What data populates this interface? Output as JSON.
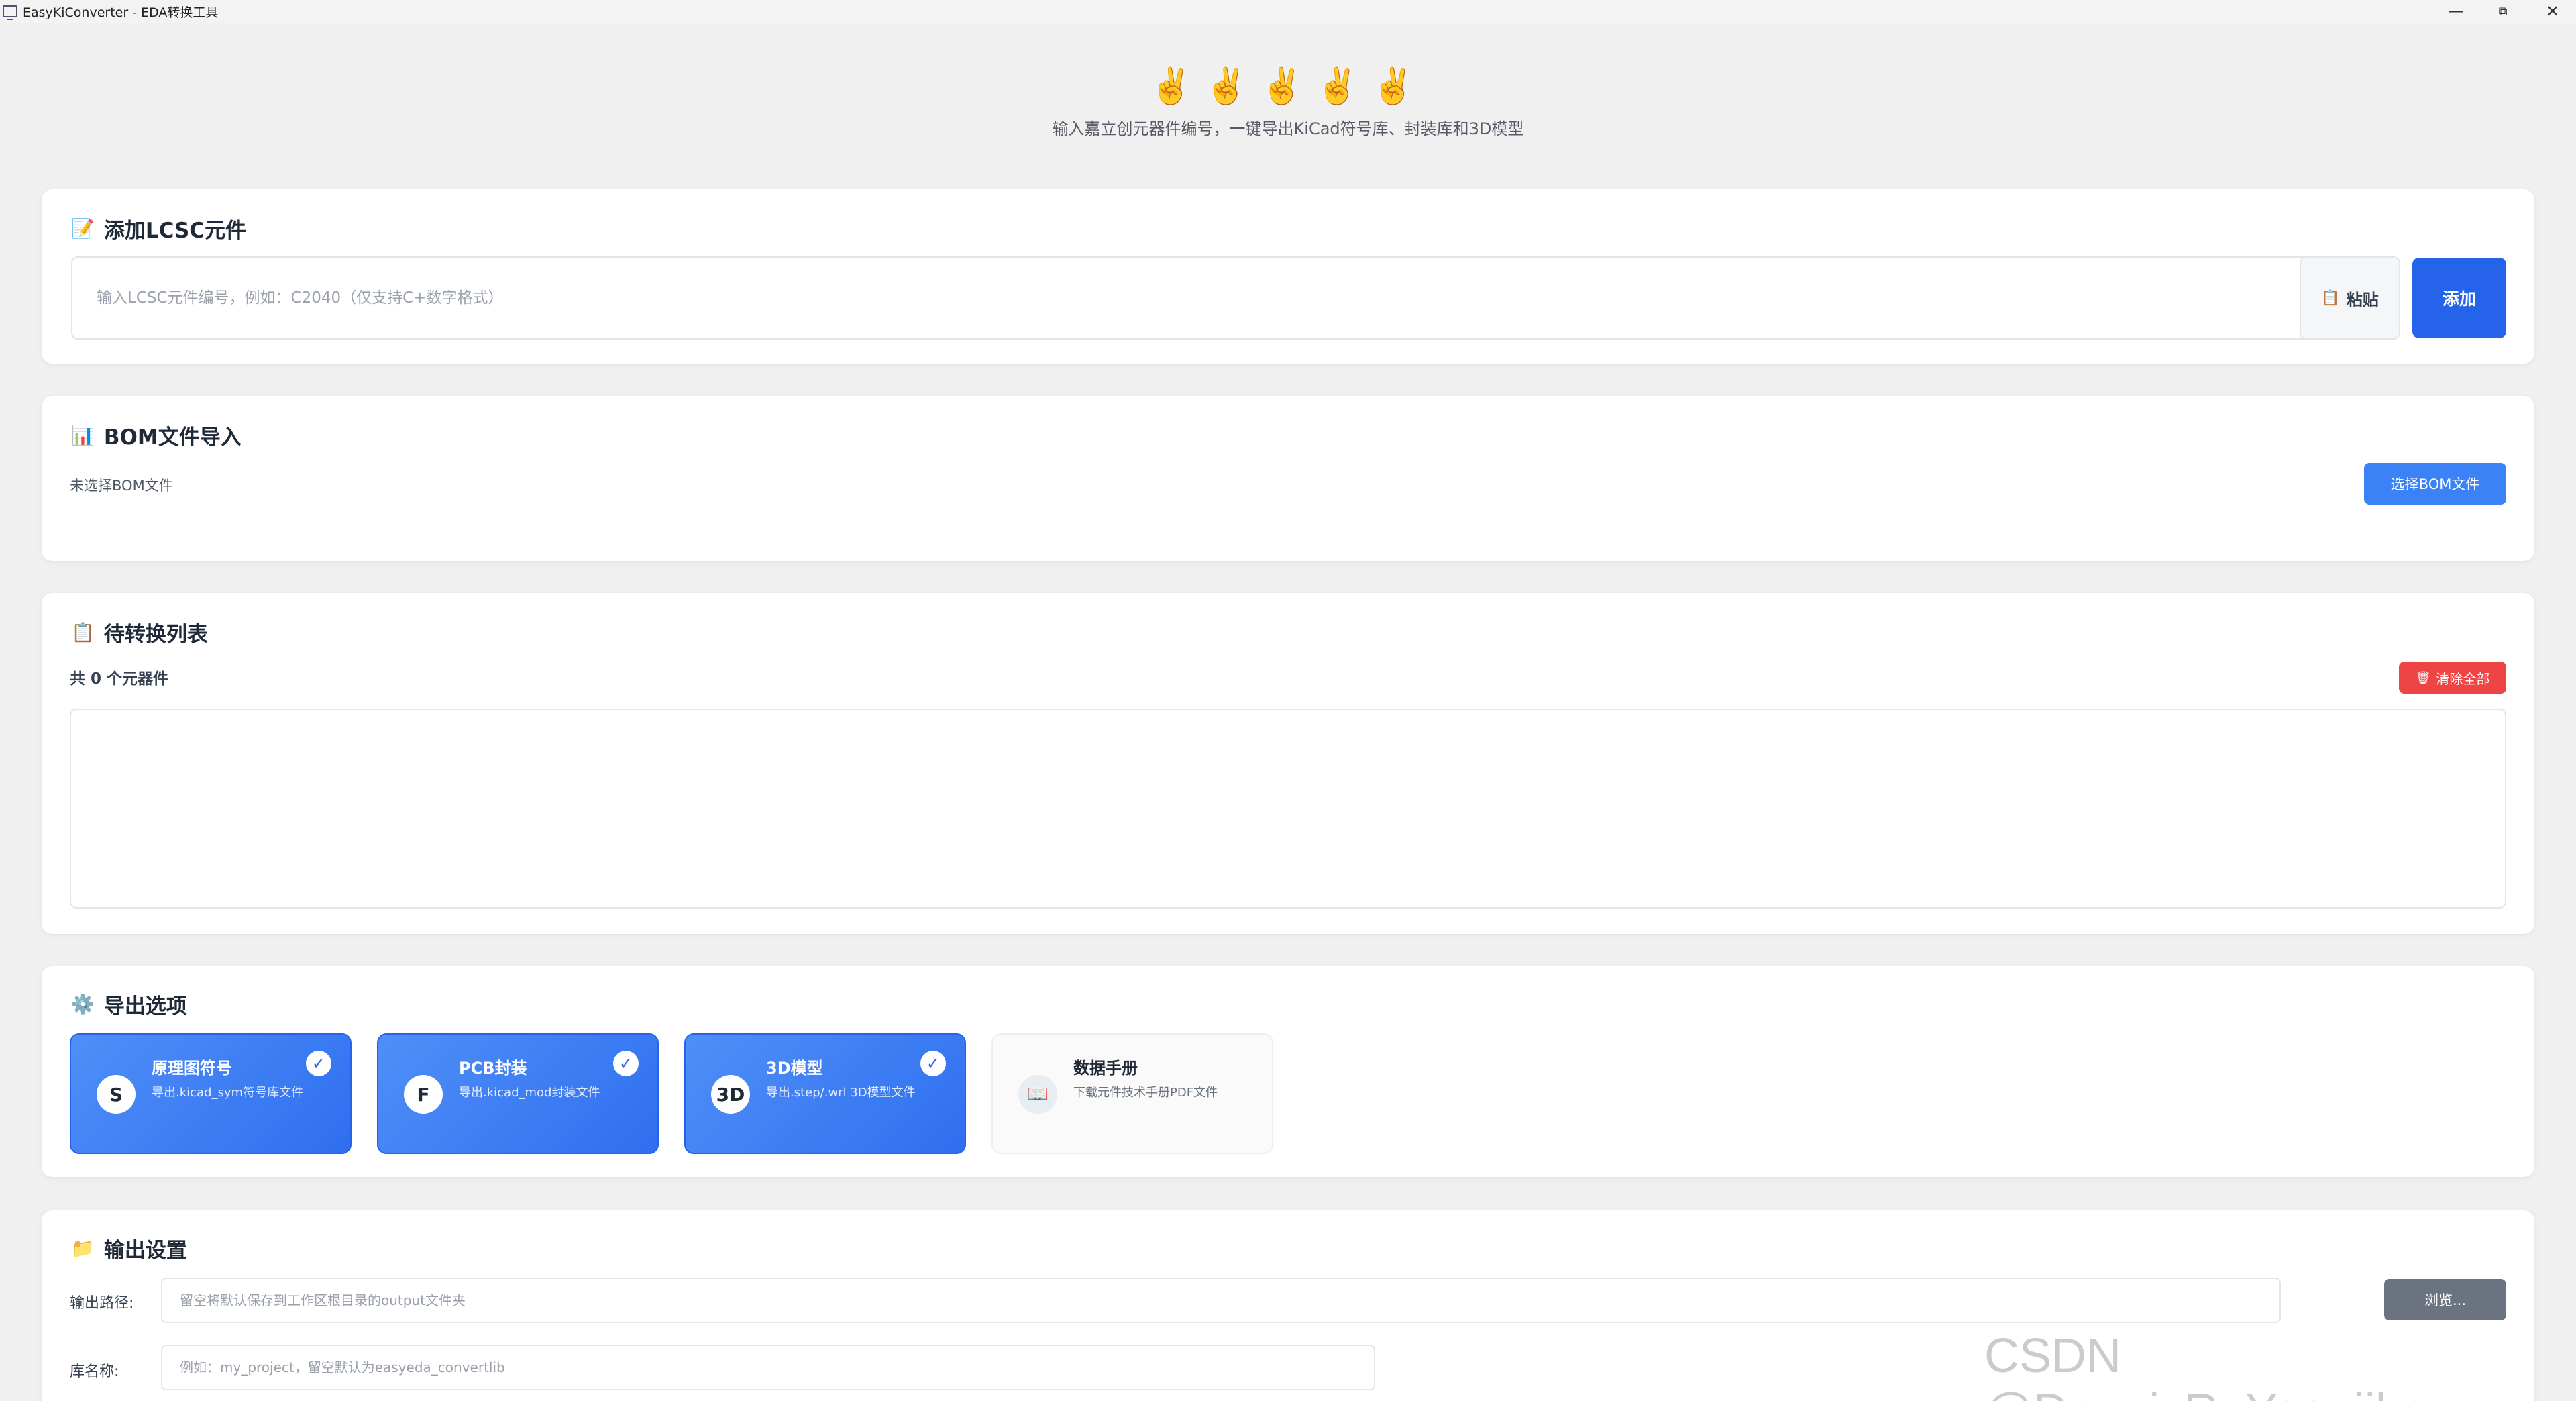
{
  "window": {
    "title": "EasyKiConverter - EDA转换工具",
    "minimize_glyph": "—",
    "maximize_glyph": "⧉",
    "close_glyph": "✕"
  },
  "header": {
    "emojis": "✌️✌️✌️✌️✌️",
    "subtitle": "输入嘉立创元器件编号，一键导出KiCad符号库、封装库和3D模型"
  },
  "lcsc_section": {
    "icon": "📝",
    "title": "添加LCSC元件",
    "input_placeholder": "输入LCSC元件编号，例如：C2040（仅支持C+数字格式）",
    "input_value": "",
    "paste_icon": "📋",
    "paste_label": "粘贴",
    "add_label": "添加"
  },
  "bom_section": {
    "icon": "📊",
    "title": "BOM文件导入",
    "status": "未选择BOM文件",
    "select_label": "选择BOM文件"
  },
  "queue_section": {
    "icon": "📋",
    "title": "待转换列表",
    "count_text": "共 0 个元器件",
    "clear_icon": "🗑",
    "clear_label": "清除全部"
  },
  "export_section": {
    "icon": "⚙️",
    "title": "导出选项",
    "options": [
      {
        "badge": "S",
        "title": "原理图符号",
        "desc": "导出.kicad_sym符号库文件",
        "checked": true
      },
      {
        "badge": "F",
        "title": "PCB封装",
        "desc": "导出.kicad_mod封装文件",
        "checked": true
      },
      {
        "badge": "3D",
        "title": "3D模型",
        "desc": "导出.step/.wrl 3D模型文件",
        "checked": true
      },
      {
        "badge": "📖",
        "title": "数据手册",
        "desc": "下载元件技术手册PDF文件",
        "checked": false
      }
    ],
    "check_glyph": "✓"
  },
  "output_section": {
    "icon": "📁",
    "title": "输出设置",
    "path_label": "输出路径:",
    "path_placeholder": "留空将默认保存到工作区根目录的output文件夹",
    "browse_label": "浏览...",
    "lib_label": "库名称:",
    "lib_placeholder": "例如：my_project，留空默认为easyeda_convertlib"
  },
  "watermark": "CSDN @DennisReYoonjiho",
  "colors": {
    "primary": "#2563eb",
    "primary_light": "#3b82f6",
    "danger": "#ef4444",
    "neutral_button": "#6b7280",
    "background": "#f0f0f1"
  }
}
